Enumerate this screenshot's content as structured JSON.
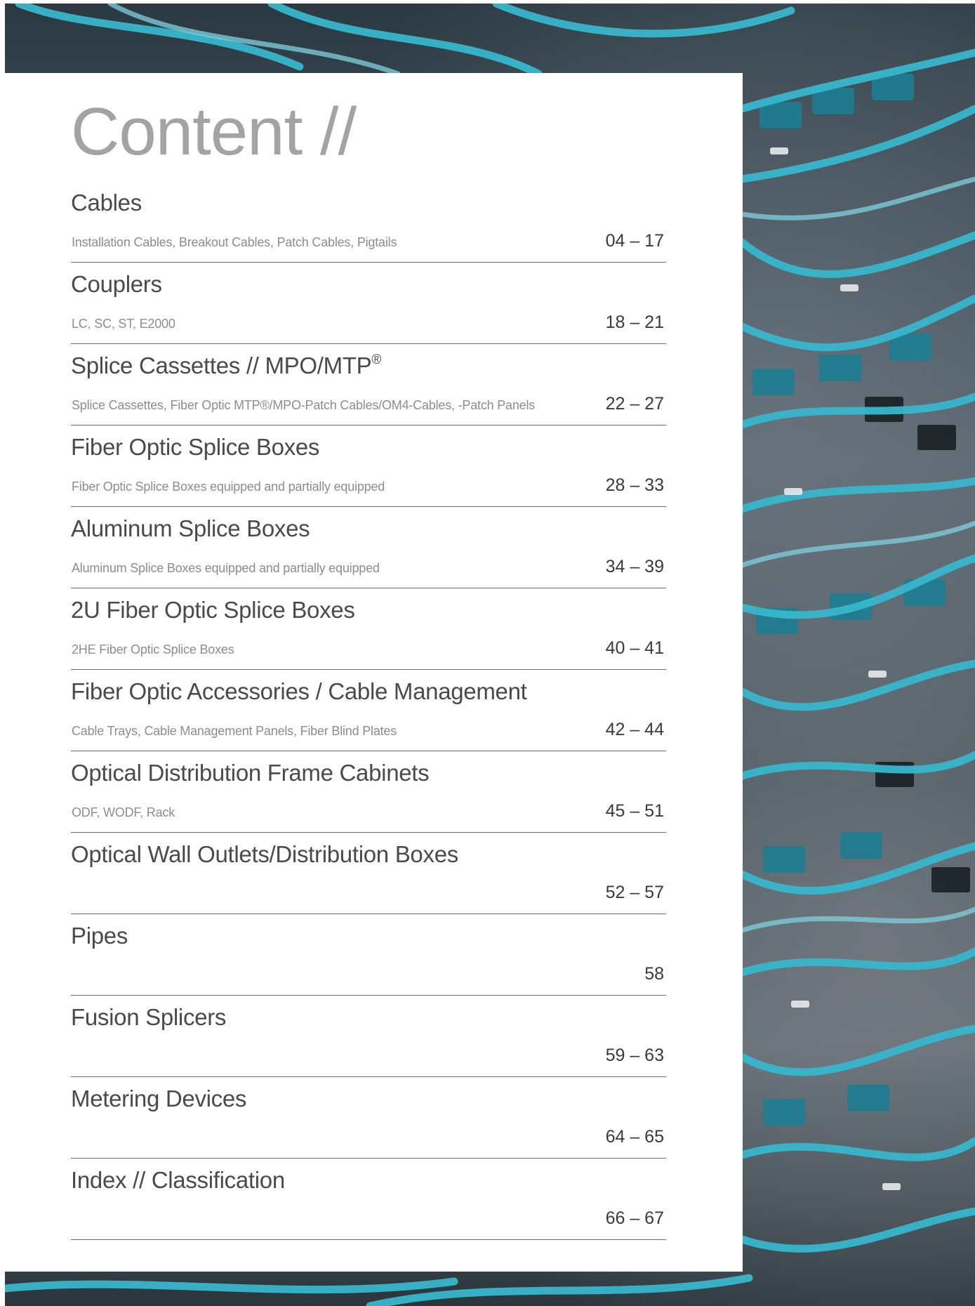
{
  "page": {
    "title": "Content //",
    "background_image": "fiber-optic-patch-cables-photo",
    "accent_color": "#2fb0c6"
  },
  "toc": [
    {
      "title": "Cables",
      "sub": "Installation Cables, Breakout Cables, Patch Cables, Pigtails",
      "pages": "04 – 17"
    },
    {
      "title": "Couplers",
      "sub": "LC, SC, ST, E2000",
      "pages": "18 – 21"
    },
    {
      "title": "Splice Cassettes // MPO/MTP",
      "sup": "®",
      "sub": "Splice Cassettes, Fiber Optic MTP®/MPO-Patch Cables/OM4-Cables, -Patch Panels",
      "pages": "22 – 27"
    },
    {
      "title": "Fiber Optic Splice Boxes",
      "sub": "Fiber Optic Splice Boxes equipped and partially equipped",
      "pages": "28 – 33"
    },
    {
      "title": "Aluminum Splice Boxes",
      "sub": "Aluminum Splice Boxes equipped and partially equipped",
      "pages": "34 – 39"
    },
    {
      "title": "2U Fiber Optic Splice Boxes",
      "sub": "2HE Fiber Optic Splice Boxes",
      "pages": "40 – 41"
    },
    {
      "title": "Fiber Optic Accessories / Cable Management",
      "sub": "Cable Trays, Cable Management Panels, Fiber Blind Plates",
      "pages": "42 – 44"
    },
    {
      "title": "Optical Distribution Frame Cabinets",
      "sub": "ODF, WODF, Rack",
      "pages": "45 – 51"
    },
    {
      "title": "Optical Wall Outlets/Distribution Boxes",
      "sub": "",
      "pages": "52 – 57"
    },
    {
      "title": "Pipes",
      "sub": "",
      "pages": "58"
    },
    {
      "title": "Fusion Splicers",
      "sub": "",
      "pages": "59 – 63"
    },
    {
      "title": "Metering Devices",
      "sub": "",
      "pages": "64 – 65"
    },
    {
      "title": "Index // Classification",
      "sub": "",
      "pages": "66 – 67"
    }
  ]
}
